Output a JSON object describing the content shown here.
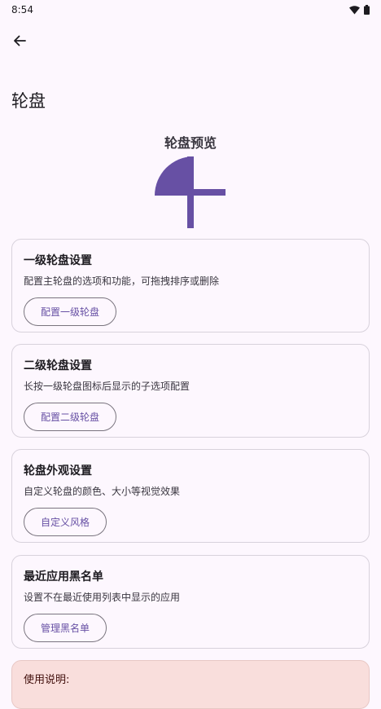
{
  "status": {
    "time": "8:54"
  },
  "header": {
    "title": "轮盘"
  },
  "preview": {
    "title": "轮盘预览"
  },
  "cards": [
    {
      "title": "一级轮盘设置",
      "desc": "配置主轮盘的选项和功能，可拖拽排序或删除",
      "button": "配置一级轮盘"
    },
    {
      "title": "二级轮盘设置",
      "desc": "长按一级轮盘图标后显示的子选项配置",
      "button": "配置二级轮盘"
    },
    {
      "title": "轮盘外观设置",
      "desc": "自定义轮盘的颜色、大小等视觉效果",
      "button": "自定义风格"
    },
    {
      "title": "最近应用黑名单",
      "desc": "设置不在最近使用列表中显示的应用",
      "button": "管理黑名单"
    }
  ],
  "info": {
    "title": "使用说明:"
  },
  "colors": {
    "accent": "#6750a4",
    "preview_shape": "#6750a4",
    "background": "#fdf7fe",
    "info_bg": "#f9dedc"
  }
}
